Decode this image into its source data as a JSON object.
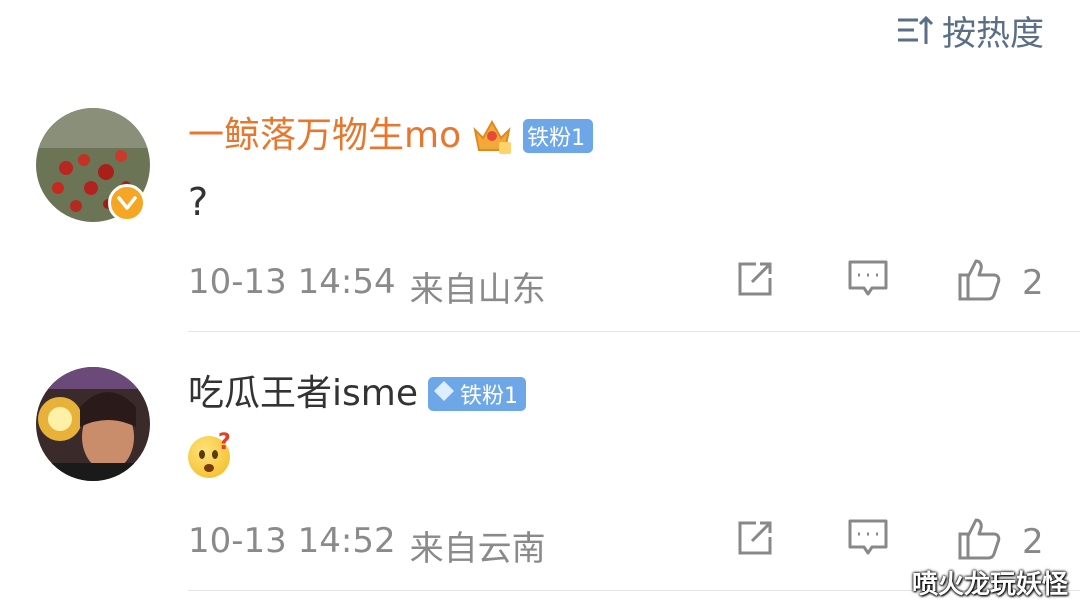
{
  "sort": {
    "label": "按热度",
    "icon": "sort-icon"
  },
  "comments": [
    {
      "username": "一鲸落万物生mo",
      "badge": "铁粉1",
      "content": "?",
      "time": "10-13 14:54",
      "location": "来自山东",
      "likes": "2"
    },
    {
      "username": "吃瓜王者isme",
      "badge": "铁粉1",
      "content": "",
      "time": "10-13 14:52",
      "location": "来自云南",
      "likes": "2"
    }
  ],
  "watermark": "喷火龙玩妖怪",
  "colors": {
    "vip_name": "#e8772e",
    "badge_bg": "#6ea7e8",
    "meta_text": "#8a8a8a",
    "verified": "#f5a623"
  }
}
